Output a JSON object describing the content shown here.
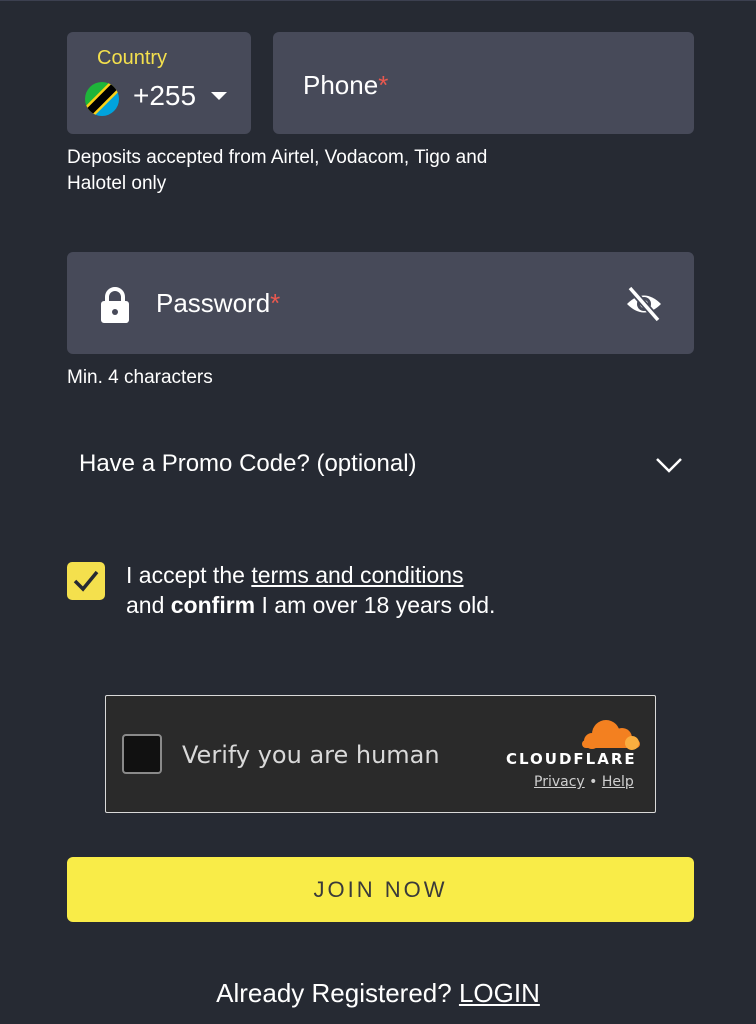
{
  "country": {
    "label": "Country",
    "code": "+255",
    "flag_icon": "tanzania-flag-icon",
    "dropdown_icon": "caret-down-icon"
  },
  "phone": {
    "label": "Phone",
    "required_mark": "*"
  },
  "phone_hint": "Deposits accepted from Airtel, Vodacom, Tigo and Halotel only",
  "password": {
    "label": "Password",
    "required_mark": "*",
    "lead_icon": "lock-icon",
    "toggle_icon": "eye-off-icon"
  },
  "password_hint": "Min. 4 characters",
  "promo": {
    "label": "Have a Promo Code? (optional)",
    "icon": "chevron-down-icon"
  },
  "terms": {
    "checked": true,
    "prefix": "I accept the",
    "link": "terms and conditions",
    "line2_start": "and",
    "line2_bold": "confirm",
    "line2_end": "I am over 18 years old."
  },
  "captcha": {
    "text": "Verify you are human",
    "brand": "CLOUDFLARE",
    "privacy": "Privacy",
    "separator": "•",
    "help": "Help"
  },
  "join_button": "JOIN NOW",
  "login_prompt": {
    "text": "Already Registered?",
    "link": "LOGIN"
  },
  "colors": {
    "background": "#262a33",
    "field": "#474a59",
    "accent_yellow": "#f9ec48",
    "required_red": "#e9584f",
    "cloudflare_orange": "#f38020"
  }
}
